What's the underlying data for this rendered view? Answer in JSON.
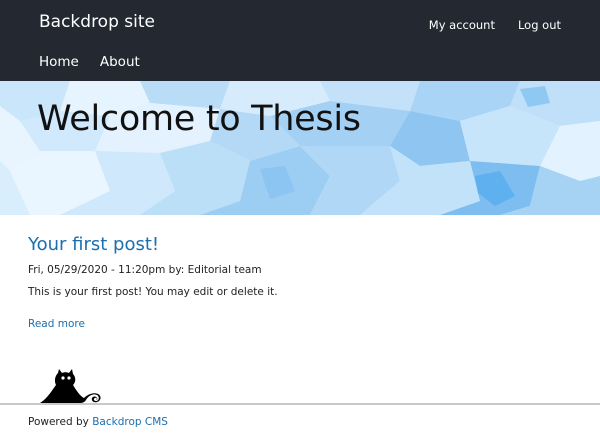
{
  "header": {
    "site_name": "Backdrop site",
    "account_menu": [
      {
        "label": "My account"
      },
      {
        "label": "Log out"
      }
    ],
    "main_menu": [
      {
        "label": "Home"
      },
      {
        "label": "About"
      }
    ],
    "background_color": "#242830"
  },
  "hero": {
    "title": "Welcome to Thesis",
    "background_colors": [
      "#dcefff",
      "#a9d4f5",
      "#6cbaf0"
    ]
  },
  "post": {
    "title": "Your first post!",
    "meta": "Fri, 05/29/2020 - 11:20pm by: Editorial team",
    "body": "This is your first post! You may edit or delete it.",
    "read_more": "Read more"
  },
  "footer": {
    "logo_icon": "backdrop-cat-icon",
    "powered_by": "Powered by",
    "cms_link": "Backdrop CMS"
  },
  "colors": {
    "link": "#1a6fae",
    "text": "#222222"
  }
}
